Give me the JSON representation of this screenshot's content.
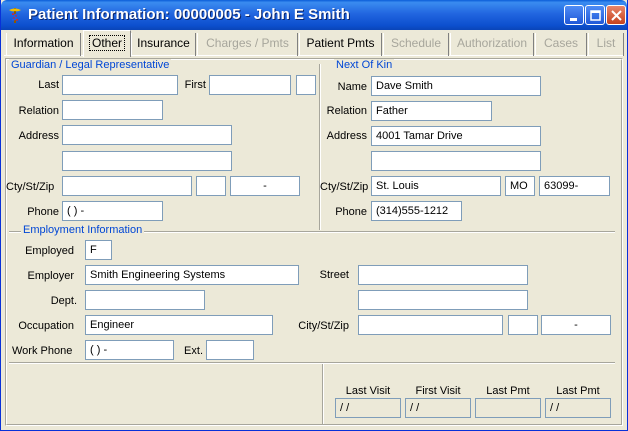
{
  "window": {
    "title": "Patient Information: 00000005 - John E Smith",
    "icon": "caduceus-icon",
    "buttons": [
      "minimize-icon",
      "maximize-icon",
      "close-icon"
    ]
  },
  "tabs": [
    {
      "label": "Information",
      "state": "normal"
    },
    {
      "label": "Other",
      "state": "active"
    },
    {
      "label": "Insurance",
      "state": "normal"
    },
    {
      "label": "Charges / Pmts",
      "state": "disabled"
    },
    {
      "label": "Patient Pmts",
      "state": "normal"
    },
    {
      "label": "Schedule",
      "state": "disabled"
    },
    {
      "label": "Authorization",
      "state": "disabled"
    },
    {
      "label": "Cases",
      "state": "disabled"
    },
    {
      "label": "List",
      "state": "disabled"
    }
  ],
  "guardian": {
    "title": "Guardian / Legal Representative",
    "last_label": "Last",
    "last": "",
    "first_label": "First",
    "first": "",
    "mi": "",
    "relation_label": "Relation",
    "relation": "",
    "address_label": "Address",
    "address1": "",
    "address2": "",
    "csz_label": "Cty/St/Zip",
    "city": "",
    "state": "",
    "zip": "-",
    "phone_label": "Phone",
    "phone": "(  )  -"
  },
  "kin": {
    "title": "Next Of Kin",
    "name_label": "Name",
    "name": "Dave Smith",
    "relation_label": "Relation",
    "relation": "Father",
    "address_label": "Address",
    "address1": "4001 Tamar Drive",
    "address2": "",
    "csz_label": "Cty/St/Zip",
    "city": "St. Louis",
    "state": "MO",
    "zip": "63099-",
    "phone_label": "Phone",
    "phone": "(314)555-1212"
  },
  "employment": {
    "title": "Employment Information",
    "employed_label": "Employed",
    "employed": "F",
    "employer_label": "Employer",
    "employer": "Smith Engineering Systems",
    "dept_label": "Dept.",
    "dept": "",
    "occupation_label": "Occupation",
    "occupation": "Engineer",
    "workphone_label": "Work Phone",
    "workphone": "(  )  -",
    "ext_label": "Ext.",
    "ext": "",
    "street_label": "Street",
    "street1": "",
    "street2": "",
    "csz_label": "City/St/Zip",
    "city": "",
    "state": "",
    "zip": "-"
  },
  "summary": {
    "last_visit_label": "Last Visit",
    "last_visit": " / /",
    "first_visit_label": "First Visit",
    "first_visit": " / /",
    "last_pmt_label": "Last Pmt",
    "last_pmt": "",
    "last_pmt2_label": "Last Pmt",
    "last_pmt2": " / /"
  }
}
